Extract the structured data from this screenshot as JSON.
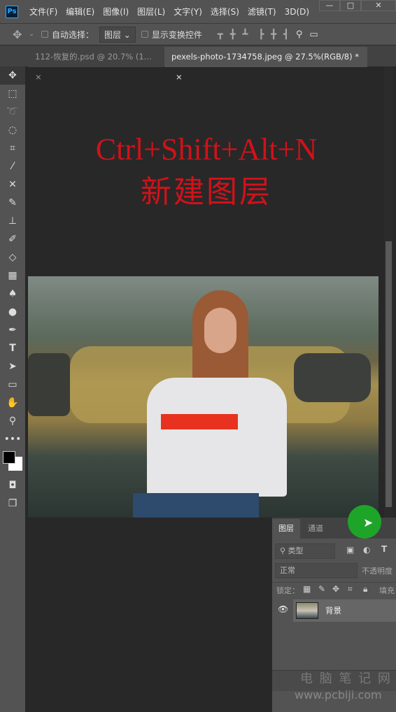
{
  "app": {
    "logo": "Ps"
  },
  "menu": [
    "文件(F)",
    "编辑(E)",
    "图像(I)",
    "图层(L)",
    "文字(Y)",
    "选择(S)",
    "滤镜(T)",
    "3D(D)"
  ],
  "window_controls": {
    "minimize": "—",
    "maximize": "□",
    "close": "✕"
  },
  "options": {
    "auto_select_label": "自动选择：",
    "auto_select_checked": false,
    "auto_select_value": "图层",
    "show_transform_label": "显示变换控件",
    "show_transform_checked": false
  },
  "tabs": [
    {
      "label": "112-恢复的.psd @ 20.7% (1...",
      "active": false,
      "close": "×"
    },
    {
      "label": "pexels-photo-1734758.jpeg @ 27.5%(RGB/8) *",
      "active": true,
      "close": "×"
    }
  ],
  "canvas": {
    "line1": "Ctrl+Shift+Alt+N",
    "line2": "新建图层",
    "text_color": "#d0121a"
  },
  "layers_panel": {
    "tabs": [
      "图层",
      "通道"
    ],
    "filter_placeholder": "类型",
    "blend_mode": "正常",
    "opacity_label": "不透明度",
    "lock_label": "锁定：",
    "fill_label": "填充",
    "layers": [
      {
        "name": "背景",
        "visible": true
      }
    ]
  },
  "watermark": {
    "line1": "电 脑 笔 记 网",
    "line2": "www.pcbiji.com"
  }
}
